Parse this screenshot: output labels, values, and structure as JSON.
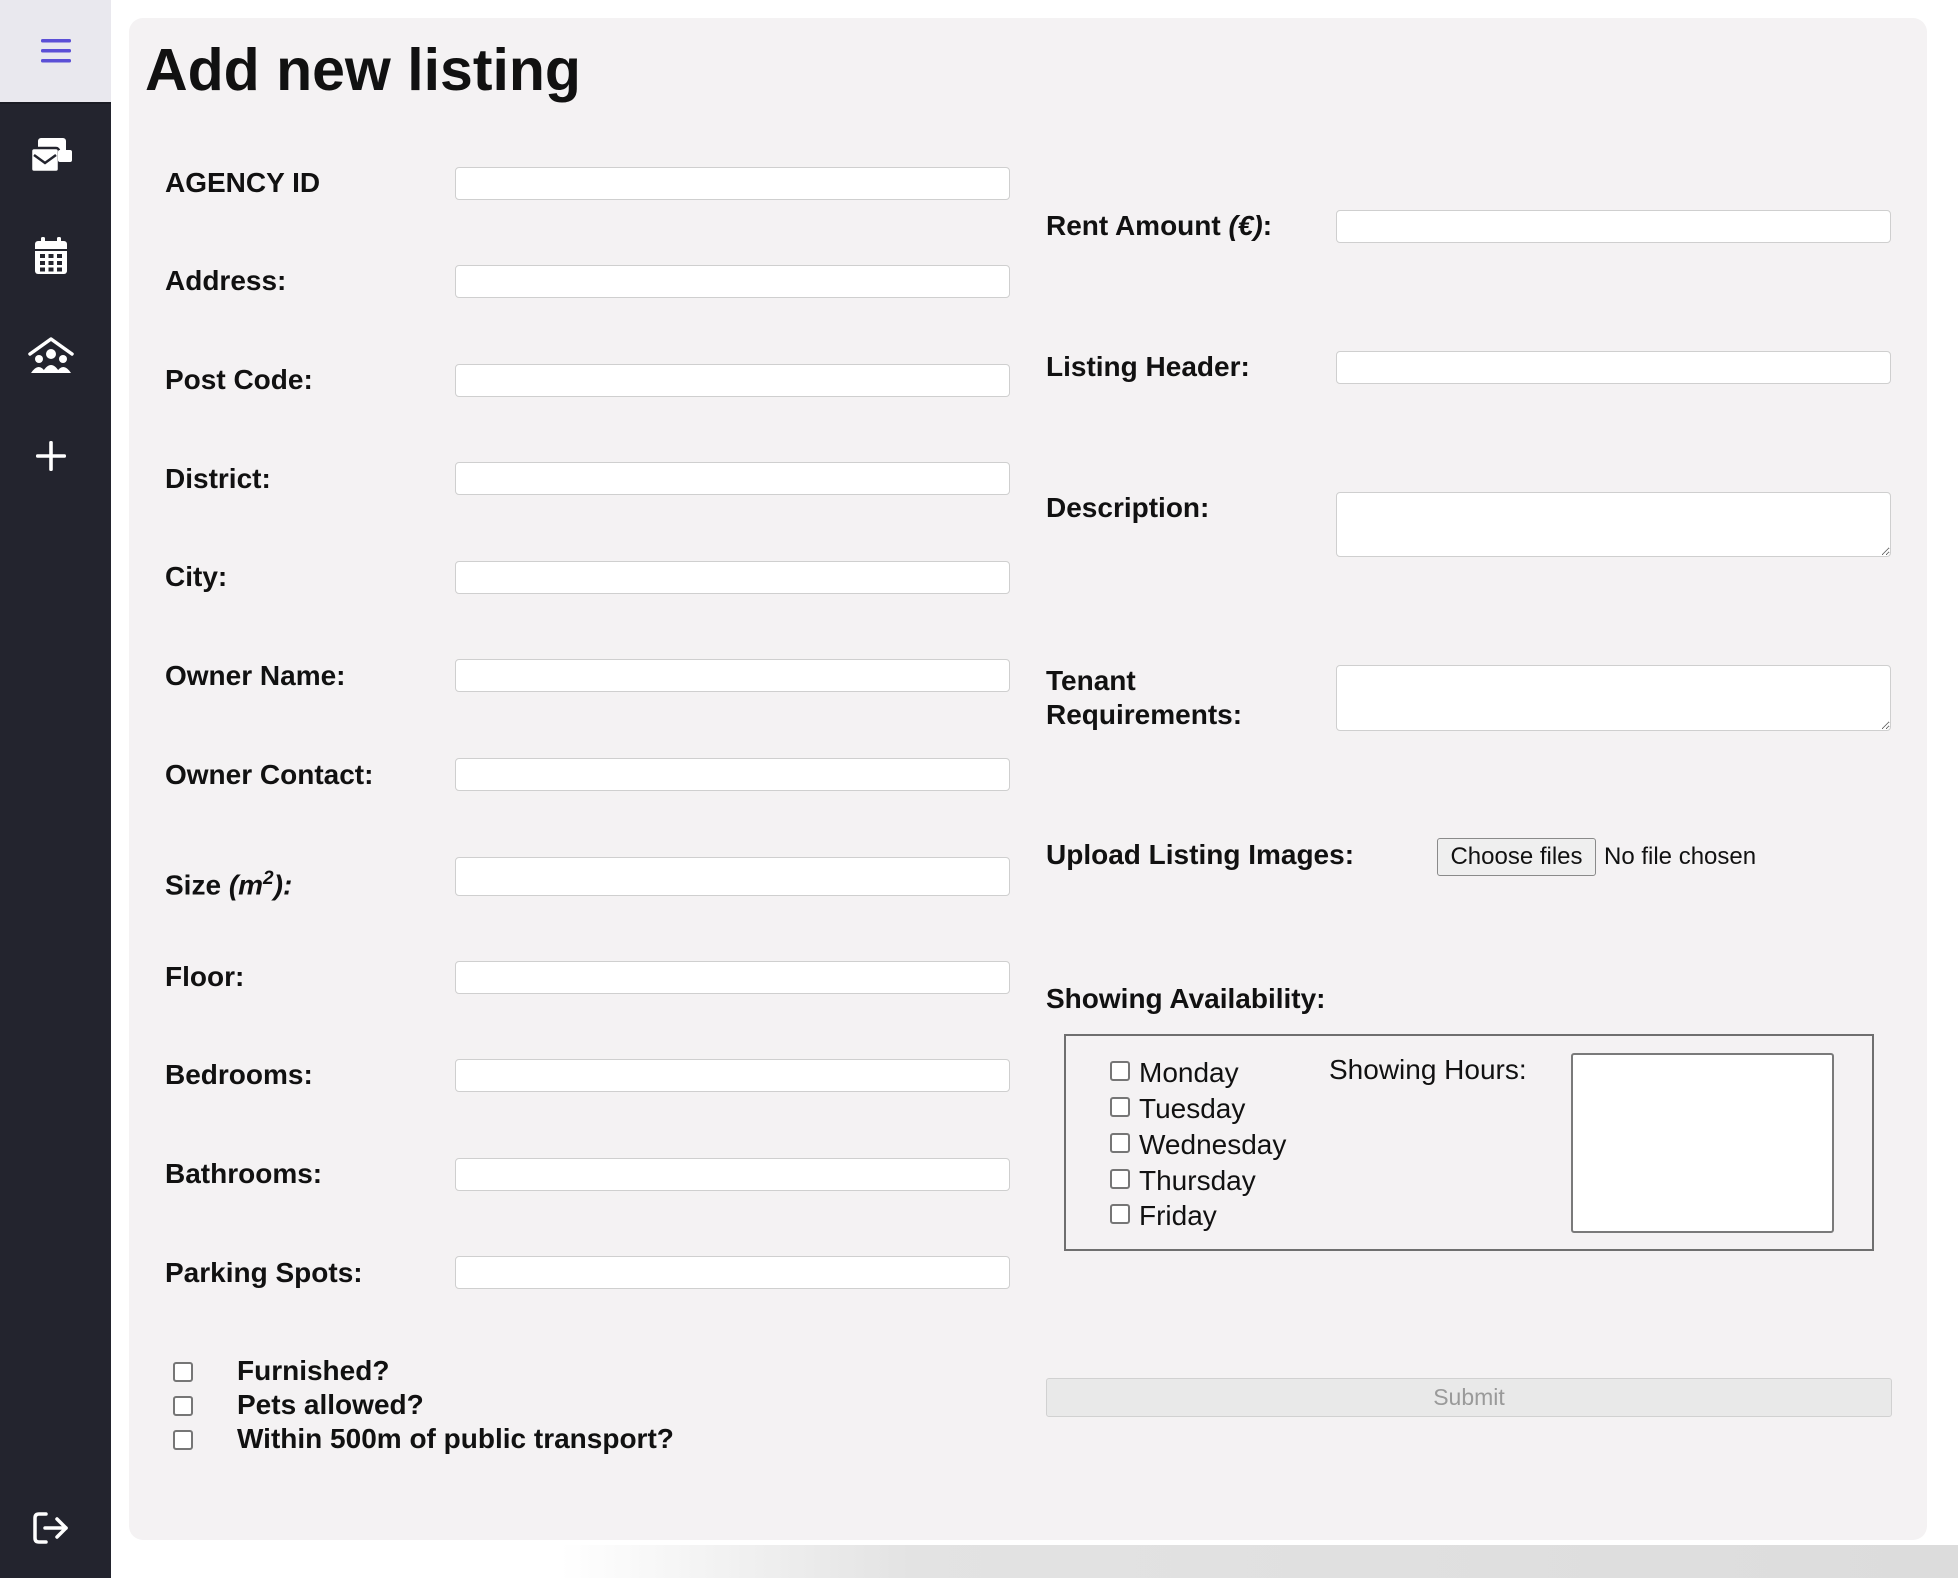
{
  "page": {
    "title": "Add new listing"
  },
  "sidebar": {
    "items": [
      {
        "name": "menu",
        "icon": "hamburger-menu-icon"
      },
      {
        "name": "inbox",
        "icon": "inbox-cards-icon"
      },
      {
        "name": "calendar",
        "icon": "calendar-icon"
      },
      {
        "name": "clients",
        "icon": "people-house-icon"
      },
      {
        "name": "add",
        "icon": "plus-icon"
      },
      {
        "name": "logout",
        "icon": "logout-icon"
      }
    ],
    "accent_color": "#5b4fd6"
  },
  "form": {
    "left": {
      "agency_id": {
        "label": "AGENCY ID",
        "value": ""
      },
      "address": {
        "label": "Address:",
        "value": ""
      },
      "post_code": {
        "label": "Post Code:",
        "value": ""
      },
      "district": {
        "label": "District:",
        "value": ""
      },
      "city": {
        "label": "City:",
        "value": ""
      },
      "owner_name": {
        "label": "Owner Name:",
        "value": ""
      },
      "owner_contact": {
        "label": "Owner Contact:",
        "value": ""
      },
      "size": {
        "label_prefix": "Size ",
        "label_unit": "(m",
        "label_sup": "2",
        "label_suffix": "):",
        "value": ""
      },
      "floor": {
        "label": "Floor:",
        "value": ""
      },
      "bedrooms": {
        "label": "Bedrooms:",
        "value": ""
      },
      "bathrooms": {
        "label": "Bathrooms:",
        "value": ""
      },
      "parking_spots": {
        "label": "Parking Spots:",
        "value": ""
      }
    },
    "amenities": [
      {
        "label": "Furnished?",
        "checked": false
      },
      {
        "label": "Pets allowed?",
        "checked": false
      },
      {
        "label": "Within 500m of public transport?",
        "checked": false
      }
    ],
    "right": {
      "rent_amount": {
        "label_prefix": "Rent Amount ",
        "label_unit": "(€)",
        "label_suffix": ":",
        "value": ""
      },
      "listing_header": {
        "label": "Listing Header:",
        "value": ""
      },
      "description": {
        "label": "Description:",
        "value": ""
      },
      "tenant_requirements": {
        "label_line1": "Tenant",
        "label_line2": "Requirements:",
        "value": ""
      },
      "upload_images": {
        "label": "Upload Listing Images:",
        "button_label": "Choose files",
        "status": "No file chosen"
      }
    },
    "showing_availability": {
      "label": "Showing Availability:",
      "days": [
        {
          "label": "Monday",
          "checked": false
        },
        {
          "label": "Tuesday",
          "checked": false
        },
        {
          "label": "Wednesday",
          "checked": false
        },
        {
          "label": "Thursday",
          "checked": false
        },
        {
          "label": "Friday",
          "checked": false
        }
      ],
      "hours_label": "Showing Hours:",
      "hours_value": ""
    },
    "submit_label": "Submit"
  }
}
